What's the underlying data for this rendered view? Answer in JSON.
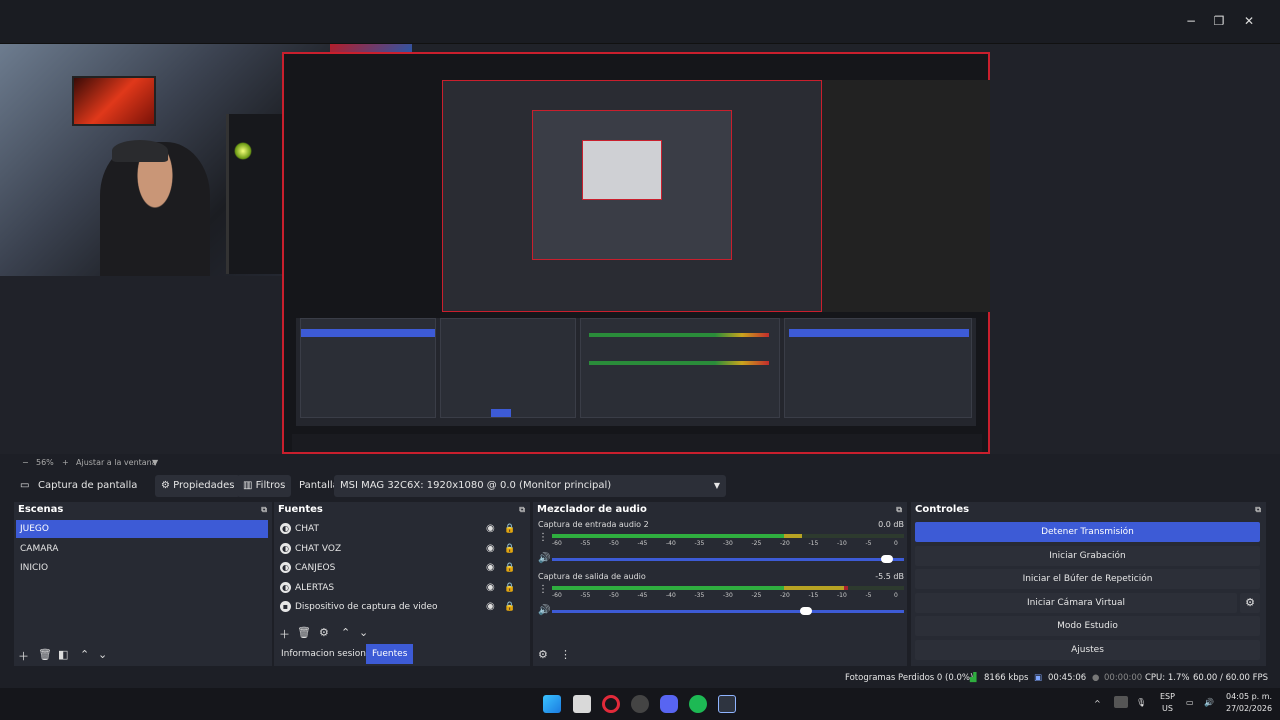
{
  "window": {
    "minimize": "−",
    "restore": "❐",
    "close": "✕"
  },
  "preview": {
    "zoom_level": "56%",
    "zoom_plus": "+",
    "zoom_minus": "−",
    "fit_label": "Ajustar a la ventana",
    "fit_caret": "▼"
  },
  "source_toolbar": {
    "capture_label": "Captura de pantalla",
    "properties_label": "Propiedades",
    "filters_label": "Filtros",
    "screen_label": "Pantalla",
    "screen_value": "MSI MAG 32C6X: 1920x1080 @ 0.0 (Monitor principal)"
  },
  "scenes": {
    "title": "Escenas",
    "items": [
      "JUEGO",
      "CAMARA",
      "INICIO"
    ],
    "selected": 0
  },
  "sources": {
    "title": "Fuentes",
    "items": [
      {
        "label": "CHAT",
        "icon": "browser-icon"
      },
      {
        "label": "CHAT VOZ",
        "icon": "browser-icon"
      },
      {
        "label": "CANJEOS",
        "icon": "browser-icon"
      },
      {
        "label": "ALERTAS",
        "icon": "browser-icon"
      },
      {
        "label": "Dispositivo de captura de video",
        "icon": "camera-icon"
      }
    ],
    "tabs": [
      "Informacion sesion",
      "Fuentes"
    ],
    "active_tab": 1
  },
  "mixer": {
    "title": "Mezclador de audio",
    "channels": [
      {
        "name": "Captura de entrada audio 2",
        "db": "0.0 dB",
        "level": 0.71,
        "volume": 0.97
      },
      {
        "name": "Captura de salida de audio",
        "db": "-5.5 dB",
        "level": 0.84,
        "volume": 0.74
      }
    ],
    "ticks": [
      "-60",
      "-55",
      "-50",
      "-45",
      "-40",
      "-35",
      "-30",
      "-25",
      "-20",
      "-15",
      "-10",
      "-5",
      "0"
    ]
  },
  "controls": {
    "title": "Controles",
    "buttons": [
      "Detener Transmisión",
      "Iniciar Grabación",
      "Iniciar el Búfer de Repetición",
      "Iniciar Cámara Virtual",
      "Modo Estudio",
      "Ajustes"
    ]
  },
  "status": {
    "dropped": "Fotogramas Perdidos 0 (0.0%)",
    "bitrate": "8166 kbps",
    "stream_time": "00:45:06",
    "rec_time": "00:00:00",
    "cpu": "CPU: 1.7%",
    "fps": "60.00 / 60.00 FPS"
  },
  "taskbar": {
    "lang": "ESP",
    "region": "US",
    "time": "04:05 p. m.",
    "date": "27/02/2026",
    "tray_caret": "^"
  },
  "colors": {
    "accent": "#3d5bd6",
    "recording_border": "#c91f2d"
  }
}
